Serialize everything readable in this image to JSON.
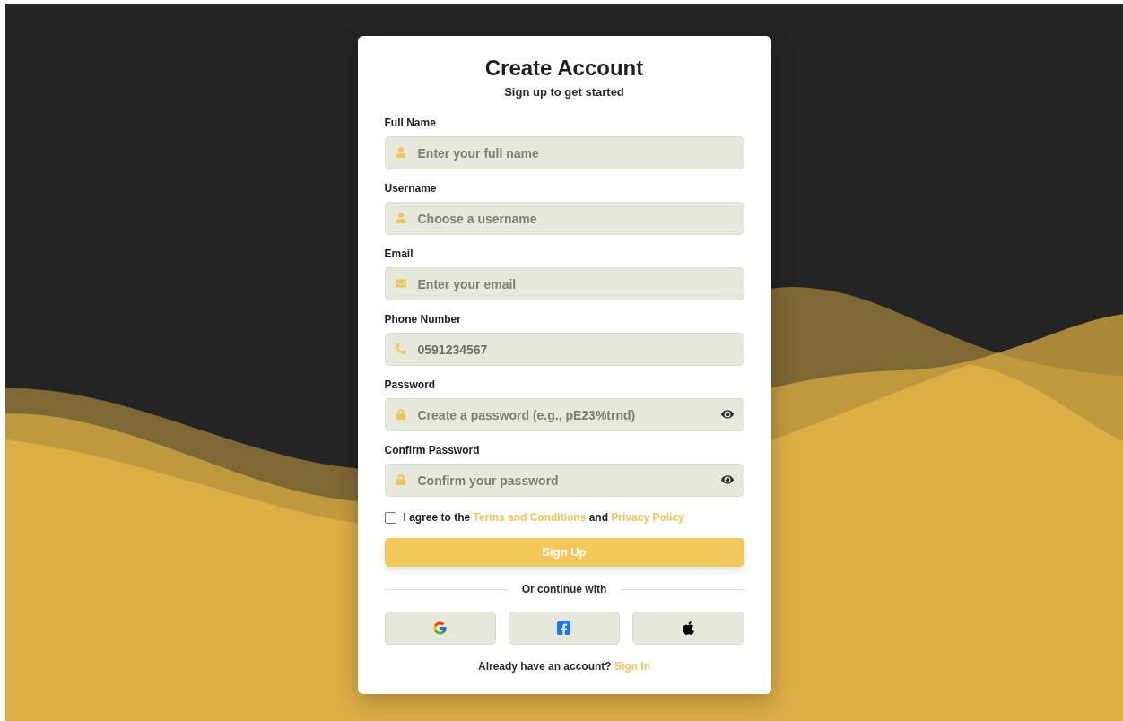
{
  "card": {
    "title": "Create Account",
    "subtitle": "Sign up to get started"
  },
  "fields": [
    {
      "kind": "text",
      "label": "Full Name",
      "placeholder": "Enter your full name"
    },
    {
      "kind": "text",
      "label": "Username",
      "placeholder": "Choose a username"
    },
    {
      "kind": "email",
      "label": "Email",
      "placeholder": "Enter your email"
    },
    {
      "kind": "phone",
      "label": "Phone Number",
      "value": "0591234567"
    },
    {
      "kind": "password",
      "label": "Password",
      "placeholder": "Create a password (e.g., pE23%trnd)"
    },
    {
      "kind": "password",
      "label": "Confirm Password",
      "placeholder": "Confirm your password"
    }
  ],
  "agreement": {
    "checked": false,
    "prefix": "I agree to the",
    "terms_link": "Terms and Conditions",
    "middle": "and",
    "privacy_link": "Privacy Policy"
  },
  "submit_button": "Sign Up",
  "divider_text": "Or continue with",
  "social_buttons": [
    {
      "kind": "google"
    },
    {
      "kind": "facebook"
    },
    {
      "kind": "apple"
    }
  ],
  "footer": {
    "text": "Already have an account?",
    "link": "Sign In"
  }
}
